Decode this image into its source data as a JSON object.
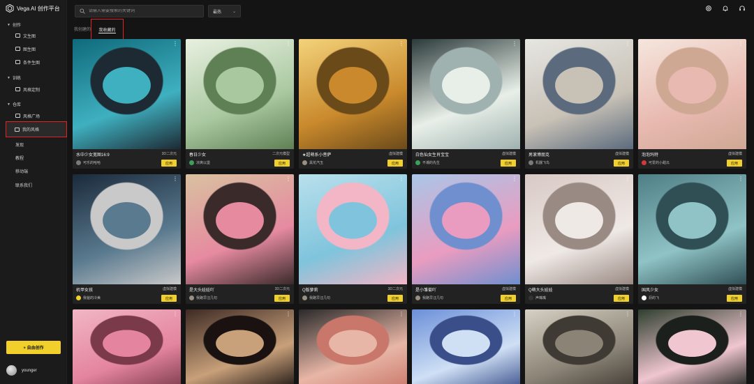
{
  "app": {
    "title": "Vega AI 创作平台"
  },
  "sidebar": {
    "sections": [
      {
        "label": "创作",
        "items": [
          "文生图",
          "图生图",
          "条件生图"
        ]
      },
      {
        "label": "训练",
        "items": [
          "风格定制"
        ]
      },
      {
        "label": "仓库",
        "items": [
          "风格广场",
          "我的风格"
        ]
      }
    ],
    "links": [
      "发现",
      "教程",
      "移动端",
      "联系我们"
    ],
    "create_button": "+ 自由创作",
    "user_name": "younger"
  },
  "topbar": {
    "search_placeholder": "请输入需要搜索的关键词",
    "sort_value": "最热",
    "icons": [
      "settings-icon",
      "bell-icon",
      "headset-icon"
    ]
  },
  "tabs": {
    "inactive": "我创建的",
    "active": "我收藏的"
  },
  "apply_label": "应用",
  "cards": [
    {
      "title": "水中少女宽图16:9",
      "tag": "3D二次元",
      "author": "可乐的哈哈",
      "colors": [
        "#0f6a7a",
        "#3fb0c0",
        "#1d2a33"
      ],
      "avatar": "#7a7a7a"
    },
    {
      "title": "春日少女",
      "tag": "二次元模型",
      "author": "凉爽以堡",
      "colors": [
        "#e8f0e0",
        "#a9c8a0",
        "#5f7f55"
      ],
      "avatar": "#3da05a"
    },
    {
      "title": "★超萌系小菩萨",
      "tag": "虚拟建模",
      "author": "黑花汽玉",
      "colors": [
        "#f3d27a",
        "#c9892c",
        "#6b4a1a"
      ],
      "avatar": "#9a8f80"
    },
    {
      "title": "白色仙女生肖宝宝",
      "tag": "虚拟建模",
      "author": "不潮的先生",
      "colors": [
        "#2b3a3a",
        "#e8efe8",
        "#9fb2b0"
      ],
      "avatar": "#3da05a"
    },
    {
      "title": "男滚博朋克",
      "tag": "虚拟建模",
      "author": "机器飞鸟",
      "colors": [
        "#e6e6e2",
        "#c8c1b6",
        "#5b6b7d"
      ],
      "avatar": "#7a7a7a"
    },
    {
      "title": "泡泡玛特",
      "tag": "虚拟建模",
      "author": "可爱的小甜瓜",
      "colors": [
        "#f5e6dd",
        "#e8b9b0",
        "#cfa894"
      ],
      "avatar": "#d23a3a"
    },
    {
      "title": "机甲女孩",
      "tag": "虚拟建模",
      "author": "我爸的冷美",
      "colors": [
        "#1a2a3a",
        "#5a7a8f",
        "#c9c9c9"
      ],
      "avatar": "#f2d02c"
    },
    {
      "title": "是大头娃娃吖",
      "tag": "3D二次元",
      "author": "我路早汪几句",
      "colors": [
        "#d9c1a0",
        "#e68aa0",
        "#3a2a2a"
      ],
      "avatar": "#9a8f80"
    },
    {
      "title": "Q版萝莉",
      "tag": "3D二次元",
      "author": "我路早汪几句",
      "colors": [
        "#b9e0ec",
        "#7fc4dc",
        "#f2b6c6"
      ],
      "avatar": "#9a8f80"
    },
    {
      "title": "是小雏菊吖",
      "tag": "虚拟建模",
      "author": "我路早汪几句",
      "colors": [
        "#a9c6e8",
        "#e99cc0",
        "#6f8fcf"
      ],
      "avatar": "#9a8f80"
    },
    {
      "title": "Q萌大头娃娃",
      "tag": "虚拟建模",
      "author": "声嘴嘴",
      "colors": [
        "#d8c9c4",
        "#efe9e6",
        "#9a8a84"
      ],
      "avatar": "#333333"
    },
    {
      "title": "国风少女",
      "tag": "虚拟建模",
      "author": "沥的飞",
      "colors": [
        "#4f7f86",
        "#8fc3c5",
        "#2f4f55"
      ],
      "avatar": "#ffffff"
    },
    {
      "title": "",
      "tag": "",
      "author": "",
      "colors": [
        "#f1b6c4",
        "#e4849e",
        "#7a3a4a"
      ],
      "avatar": "#7a7a7a"
    },
    {
      "title": "",
      "tag": "",
      "author": "",
      "colors": [
        "#3d2a24",
        "#c8a07a",
        "#1a1210"
      ],
      "avatar": "#7a7a7a"
    },
    {
      "title": "",
      "tag": "",
      "author": "",
      "colors": [
        "#2a2a2a",
        "#e8b6a6",
        "#c9776a"
      ],
      "avatar": "#7a7a7a"
    },
    {
      "title": "",
      "tag": "",
      "author": "",
      "colors": [
        "#6b8fd9",
        "#cfe0f5",
        "#3a4f8a"
      ],
      "avatar": "#7a7a7a"
    },
    {
      "title": "",
      "tag": "",
      "author": "",
      "colors": [
        "#d6d1c4",
        "#8a8376",
        "#3f3a33"
      ],
      "avatar": "#7a7a7a"
    },
    {
      "title": "",
      "tag": "",
      "author": "",
      "colors": [
        "#2f3f2f",
        "#f0c6d0",
        "#1c201c"
      ],
      "avatar": "#7a7a7a"
    }
  ]
}
